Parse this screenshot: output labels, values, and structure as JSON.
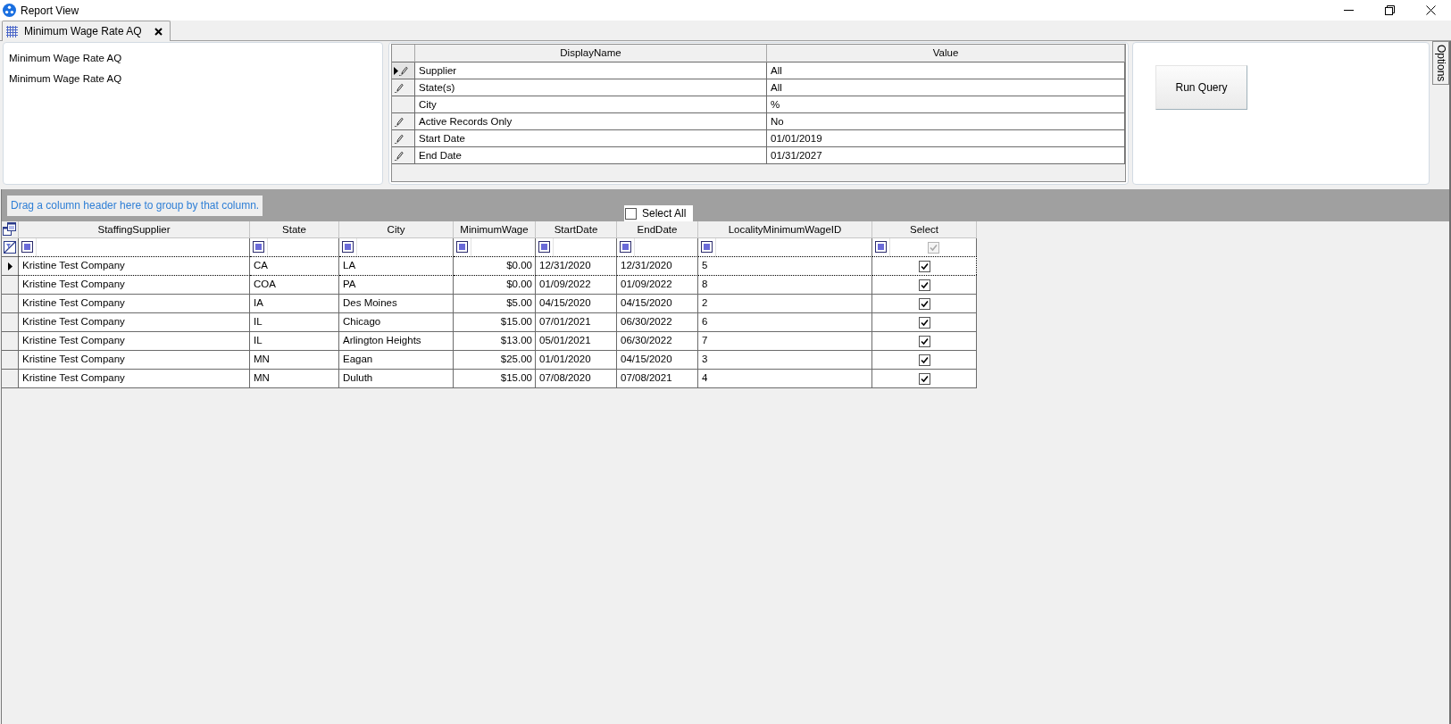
{
  "window": {
    "title": "Report View"
  },
  "tabs": [
    {
      "label": "Minimum Wage Rate AQ",
      "selected": true
    }
  ],
  "info_panel": {
    "lines": [
      "Minimum Wage Rate AQ",
      "Minimum Wage Rate AQ"
    ]
  },
  "parameters": {
    "columns": [
      "DisplayName",
      "Value"
    ],
    "rows": [
      {
        "name": "Supplier",
        "value": "All",
        "selected": true,
        "edited": true
      },
      {
        "name": "State(s)",
        "value": "All",
        "selected": false,
        "edited": true
      },
      {
        "name": "City",
        "value": "%",
        "selected": false,
        "edited": false
      },
      {
        "name": "Active Records Only",
        "value": "No",
        "selected": false,
        "edited": true
      },
      {
        "name": "Start Date",
        "value": "01/01/2019",
        "selected": false,
        "edited": true
      },
      {
        "name": "End Date",
        "value": "01/31/2027",
        "selected": false,
        "edited": true
      }
    ]
  },
  "run_button": {
    "label": "Run Query"
  },
  "side_tab": {
    "label": "Options"
  },
  "grid": {
    "group_hint": "Drag a column header here to group by that column.",
    "select_all": {
      "label": "Select All",
      "checked": false
    },
    "columns": [
      {
        "label": "StaffingSupplier",
        "kind": "text"
      },
      {
        "label": "State",
        "kind": "text"
      },
      {
        "label": "City",
        "kind": "text"
      },
      {
        "label": "MinimumWage",
        "kind": "money"
      },
      {
        "label": "StartDate",
        "kind": "text"
      },
      {
        "label": "EndDate",
        "kind": "text"
      },
      {
        "label": "LocalityMinimumWageID",
        "kind": "text"
      },
      {
        "label": "Select",
        "kind": "check"
      }
    ],
    "filter_select": {
      "checked": true,
      "disabled": true
    },
    "rows": [
      {
        "selected": true,
        "checked": true,
        "cells": [
          "Kristine Test Company",
          "CA",
          "LA",
          "$0.00",
          "12/31/2020",
          "12/31/2020",
          "5"
        ]
      },
      {
        "selected": false,
        "checked": true,
        "cells": [
          "Kristine Test Company",
          "COA",
          "PA",
          "$0.00",
          "01/09/2022",
          "01/09/2022",
          "8"
        ]
      },
      {
        "selected": false,
        "checked": true,
        "cells": [
          "Kristine Test Company",
          "IA",
          "Des Moines",
          "$5.00",
          "04/15/2020",
          "04/15/2020",
          "2"
        ]
      },
      {
        "selected": false,
        "checked": true,
        "cells": [
          "Kristine Test Company",
          "IL",
          "Chicago",
          "$15.00",
          "07/01/2021",
          "06/30/2022",
          "6"
        ]
      },
      {
        "selected": false,
        "checked": true,
        "cells": [
          "Kristine Test Company",
          "IL",
          "Arlington Heights",
          "$13.00",
          "05/01/2021",
          "06/30/2022",
          "7"
        ]
      },
      {
        "selected": false,
        "checked": true,
        "cells": [
          "Kristine Test Company",
          "MN",
          "Eagan",
          "$25.00",
          "01/01/2020",
          "04/15/2020",
          "3"
        ]
      },
      {
        "selected": false,
        "checked": true,
        "cells": [
          "Kristine Test Company",
          "MN",
          "Duluth",
          "$15.00",
          "07/08/2020",
          "07/08/2021",
          "4"
        ]
      }
    ]
  }
}
